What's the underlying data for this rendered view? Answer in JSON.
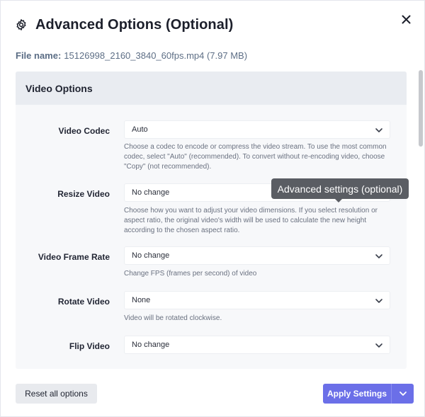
{
  "dialog": {
    "title": "Advanced Options (Optional)",
    "file_label": "File name:",
    "file_name": "15126998_2160_3840_60fps.mp4 (7.97 MB)"
  },
  "section": {
    "title": "Video Options"
  },
  "fields": {
    "codec": {
      "label": "Video Codec",
      "value": "Auto",
      "help": "Choose a codec to encode or compress the video stream. To use the most common codec, select \"Auto\" (recommended). To convert without re-encoding video, choose \"Copy\" (not recommended)."
    },
    "resize": {
      "label": "Resize Video",
      "value": "No change",
      "help": "Choose how you want to adjust your video dimensions. If you select resolution or aspect ratio, the original video's width will be used to calculate the new height according to the chosen aspect ratio."
    },
    "framerate": {
      "label": "Video Frame Rate",
      "value": "No change",
      "help": "Change FPS (frames per second) of video"
    },
    "rotate": {
      "label": "Rotate Video",
      "value": "None",
      "help": "Video will be rotated clockwise."
    },
    "flip": {
      "label": "Flip Video",
      "value": "No change"
    }
  },
  "tooltip": {
    "text": "Advanced settings (optional)"
  },
  "footer": {
    "reset_label": "Reset all options",
    "apply_label": "Apply Settings"
  },
  "colors": {
    "accent": "#6b6fe8",
    "panel_bg": "#f7f8fa",
    "panel_header_bg": "#e9ecf1",
    "tooltip_bg": "#5a5d63"
  },
  "icons": {
    "settings": "gear-icon",
    "close": "close-icon",
    "dropdown": "chevron-down-icon"
  }
}
